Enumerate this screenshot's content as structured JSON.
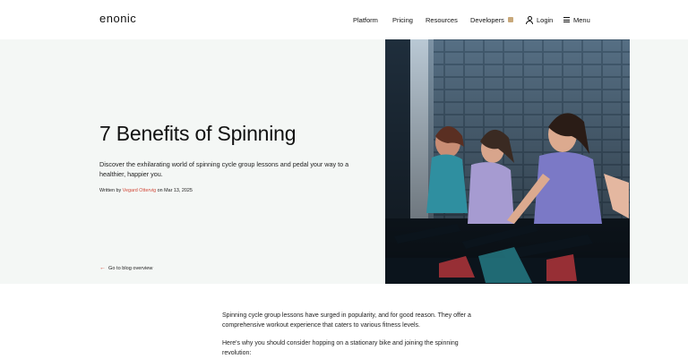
{
  "header": {
    "logo": "enonic",
    "nav": {
      "platform": "Platform",
      "pricing": "Pricing",
      "resources": "Resources",
      "developers": "Developers",
      "login": "Login",
      "menu": "Menu"
    }
  },
  "hero": {
    "title": "7 Benefits of Spinning",
    "description": "Discover the exhilarating world of spinning cycle group lessons and pedal your way to a healthier, happier you.",
    "byline": {
      "prefix": "Written by",
      "author": "Vegard Ottervig",
      "date_text": "on Mar 13, 2025"
    },
    "back_link": "Go to blog overview",
    "photo_icon": "spinning-class-photo"
  },
  "article": {
    "paragraph_1": "Spinning cycle group lessons have surged in popularity, and for good reason. They offer a comprehensive workout experience that caters to various fitness levels.",
    "paragraph_2": "Here's why you should consider hopping on a stationary bike and joining the spinning revolution:"
  },
  "colors": {
    "accent": "#d24a3a",
    "hero_bg": "#f4f7f5",
    "developers_badge": "#c8a87a"
  }
}
